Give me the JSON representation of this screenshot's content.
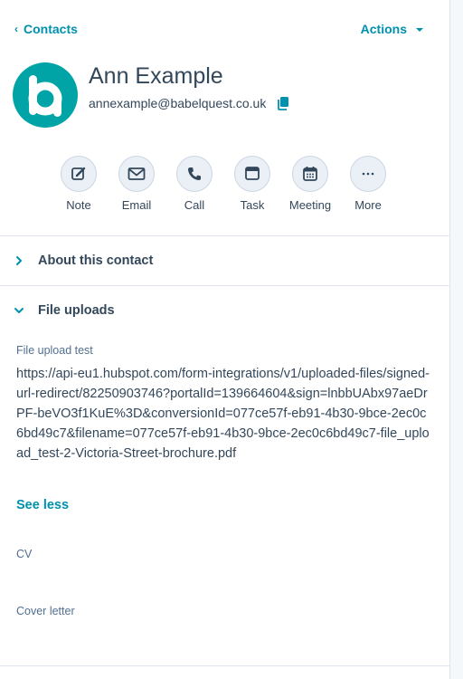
{
  "header": {
    "back_label": "Contacts",
    "actions_label": "Actions"
  },
  "contact": {
    "name": "Ann Example",
    "email": "annexample@babelquest.co.uk",
    "avatar_color": "#00a4a6"
  },
  "quick_actions": [
    {
      "label": "Note",
      "icon": "pencil-note-icon"
    },
    {
      "label": "Email",
      "icon": "envelope-icon"
    },
    {
      "label": "Call",
      "icon": "phone-icon"
    },
    {
      "label": "Task",
      "icon": "task-icon"
    },
    {
      "label": "Meeting",
      "icon": "calendar-icon"
    },
    {
      "label": "More",
      "icon": "ellipsis-icon"
    }
  ],
  "sections": {
    "about": {
      "title": "About this contact",
      "expanded": false
    },
    "files": {
      "title": "File uploads",
      "expanded": true
    }
  },
  "file_uploads": {
    "file_upload_test_label": "File upload test",
    "file_upload_test_value": "https://api-eu1.hubspot.com/form-integrations/v1/uploaded-files/signed-url-redirect/82250903746?portalId=139664604&sign=lnbbUAbx97aeDrPF-beVO3f1KuE%3D&conversionId=077ce57f-eb91-4b30-9bce-2ec0c6bd49c7&filename=077ce57f-eb91-4b30-9bce-2ec0c6bd49c7-file_upload_test-2-Victoria-Street-brochure.pdf",
    "see_less_label": "See less",
    "cv_label": "CV",
    "cover_letter_label": "Cover letter"
  },
  "colors": {
    "accent": "#0091ae",
    "text": "#33475b",
    "divider": "#dfe3eb"
  }
}
